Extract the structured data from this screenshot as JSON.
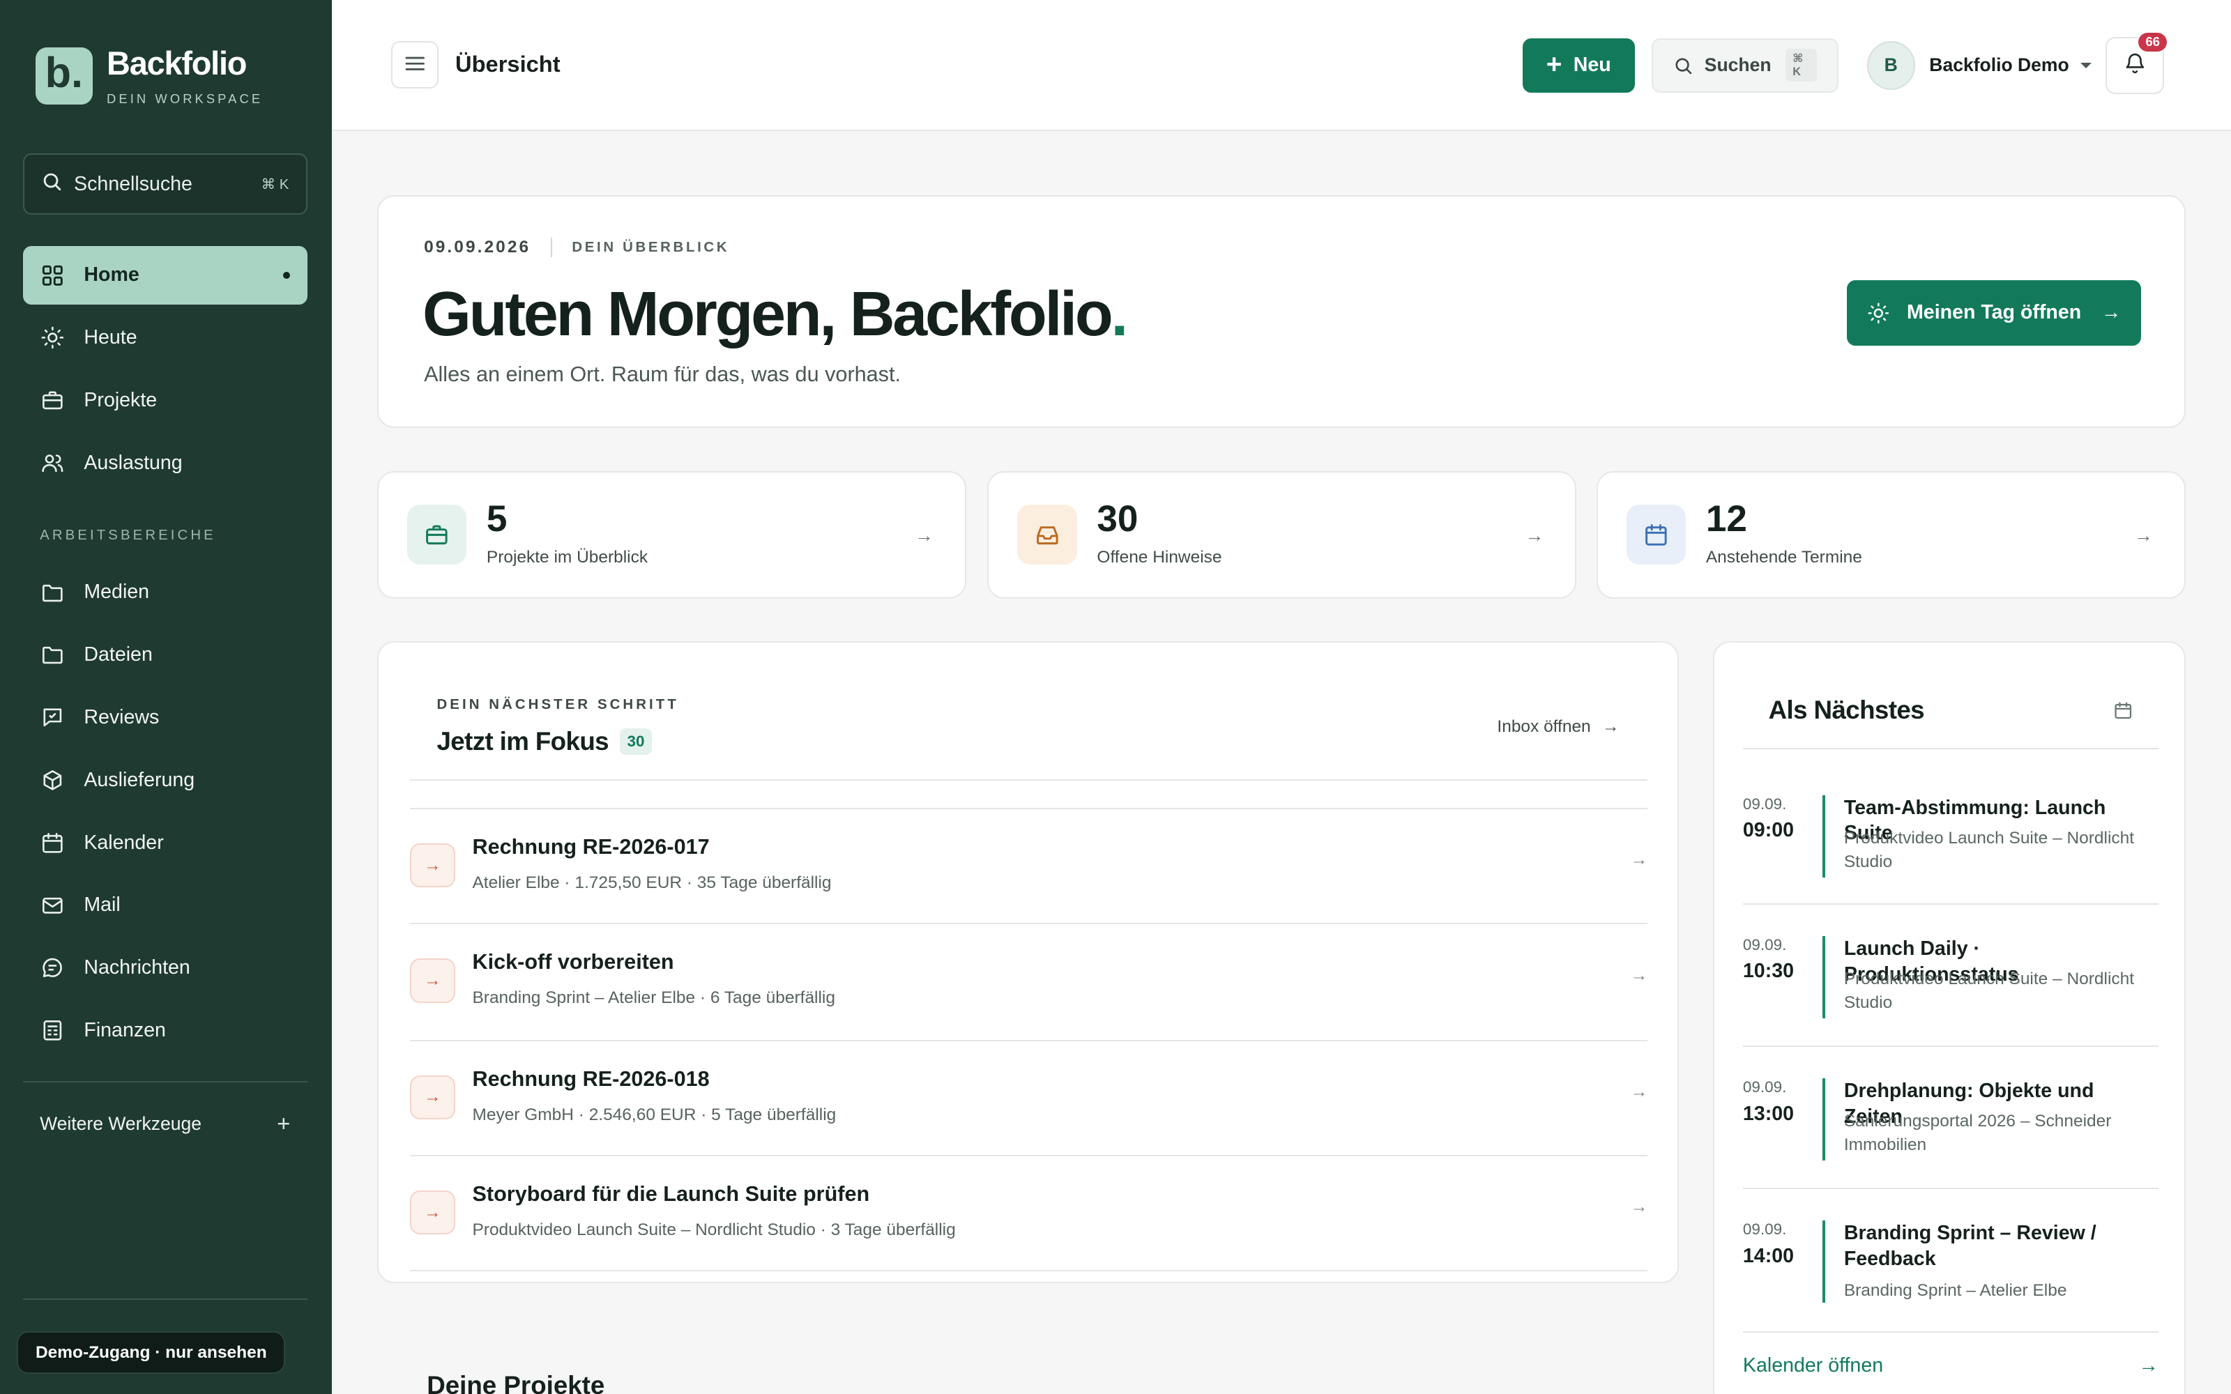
{
  "brand": {
    "name": "Backfolio",
    "logo_letter": "b.",
    "tagline": "DEIN WORKSPACE"
  },
  "sidebar": {
    "search": {
      "label": "Schnellsuche",
      "shortcut": "⌘ K"
    },
    "primary": [
      {
        "label": "Home",
        "icon": "grid-icon",
        "active": true
      },
      {
        "label": "Heute",
        "icon": "sun-icon"
      },
      {
        "label": "Projekte",
        "icon": "briefcase-icon"
      },
      {
        "label": "Auslastung",
        "icon": "users-icon"
      }
    ],
    "section_label": "ARBEITSBEREICHE",
    "workspace": [
      {
        "label": "Medien",
        "icon": "folder-icon"
      },
      {
        "label": "Dateien",
        "icon": "folder-icon"
      },
      {
        "label": "Reviews",
        "icon": "review-icon"
      },
      {
        "label": "Auslieferung",
        "icon": "package-icon"
      },
      {
        "label": "Kalender",
        "icon": "calendar-icon"
      },
      {
        "label": "Mail",
        "icon": "mail-icon"
      },
      {
        "label": "Nachrichten",
        "icon": "chat-icon"
      },
      {
        "label": "Finanzen",
        "icon": "ledger-icon"
      }
    ],
    "more_tools": "Weitere Werkzeuge",
    "demo_badge": "Demo-Zugang · nur ansehen"
  },
  "topbar": {
    "title": "Übersicht",
    "new_label": "Neu",
    "search_label": "Suchen",
    "search_shortcut": "⌘ K",
    "user_initial": "B",
    "user_name": "Backfolio Demo",
    "notifications": "66"
  },
  "hero": {
    "date": "09.09.2026",
    "overline": "DEIN ÜBERBLICK",
    "greeting": "Guten Morgen, Backfolio",
    "greeting_dot": ".",
    "subtitle": "Alles an einem Ort. Raum für das, was du vorhast.",
    "cta": "Meinen Tag öffnen"
  },
  "stats": [
    {
      "value": "5",
      "label": "Projekte im Überblick",
      "icon": "briefcase-icon",
      "color": "#127a5b",
      "bg": "#e6f2ed"
    },
    {
      "value": "30",
      "label": "Offene Hinweise",
      "icon": "inbox-icon",
      "color": "#b86a22",
      "bg": "#fbeedf"
    },
    {
      "value": "12",
      "label": "Anstehende Termine",
      "icon": "calendar-icon",
      "color": "#3a6fb5",
      "bg": "#e8eff8"
    }
  ],
  "focus": {
    "eyebrow": "DEIN NÄCHSTER SCHRITT",
    "title": "Jetzt im Fokus",
    "count": "30",
    "inbox_link": "Inbox öffnen",
    "tasks": [
      {
        "title": "Rechnung RE-2026-017",
        "sub": "Atelier Elbe · 1.725,50 EUR · 35 Tage überfällig"
      },
      {
        "title": "Kick-off vorbereiten",
        "sub": "Branding Sprint – Atelier Elbe · 6 Tage überfällig"
      },
      {
        "title": "Rechnung RE-2026-018",
        "sub": "Meyer GmbH · 2.546,60 EUR · 5 Tage überfällig"
      },
      {
        "title": "Storyboard für die Launch Suite prüfen",
        "sub": "Produktvideo Launch Suite – Nordlicht Studio · 3 Tage überfällig"
      }
    ]
  },
  "projects_heading": "Deine Projekte",
  "upcoming": {
    "title": "Als Nächstes",
    "events": [
      {
        "date": "09.09.",
        "time": "09:00",
        "title": "Team-Abstimmung: Launch Suite",
        "sub": "Produktvideo Launch Suite – Nordlicht Studio"
      },
      {
        "date": "09.09.",
        "time": "10:30",
        "title": "Launch Daily · Produktionsstatus",
        "sub": "Produktvideo Launch Suite – Nordlicht Studio"
      },
      {
        "date": "09.09.",
        "time": "13:00",
        "title": "Drehplanung: Objekte und Zeiten",
        "sub": "Sanierungsportal 2026 – Schneider Immobilien"
      },
      {
        "date": "09.09.",
        "time": "14:00",
        "title": "Branding Sprint – Review / Feedback",
        "sub": "Branding Sprint – Atelier Elbe"
      }
    ],
    "calendar_link": "Kalender öffnen"
  }
}
